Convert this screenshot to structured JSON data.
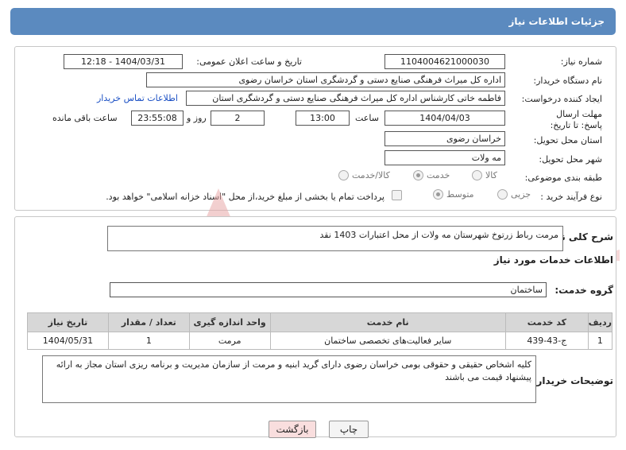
{
  "header": {
    "title": "جزئیات اطلاعات نیاز"
  },
  "form": {
    "need_number_label": "شماره نیاز:",
    "need_number": "1104004621000030",
    "announce_label": "تاریخ و ساعت اعلان عمومی:",
    "announce_value": "1404/03/31 - 12:18",
    "buyer_org_label": "نام دستگاه خریدار:",
    "buyer_org": "اداره کل میراث فرهنگی  صنایع دستی و گردشگری استان خراسان رضوی",
    "creator_label": "ایجاد کننده درخواست:",
    "creator": "فاطمه خاتی کارشناس اداره کل میراث فرهنگی  صنایع دستی و گردشگری استان",
    "contact_link": "اطلاعات تماس خریدار",
    "deadline_label": "مهلت ارسال پاسخ: تا تاریخ:",
    "deadline_date": "1404/04/03",
    "time_label": "ساعت",
    "deadline_time": "13:00",
    "days_value": "2",
    "days_label": "روز و",
    "remaining_value": "23:55:08",
    "remaining_label": "ساعت باقی مانده",
    "province_label": "استان محل تحویل:",
    "province": "خراسان رضوی",
    "city_label": "شهر محل تحویل:",
    "city": "مه ولات",
    "category_label": "طبقه بندی موضوعی:",
    "category_options": [
      "کالا",
      "خدمت",
      "کالا/خدمت"
    ],
    "process_label": "نوع فرآیند خرید :",
    "process_options": [
      "جزیی",
      "متوسط"
    ],
    "payment_note": "پرداخت تمام یا بخشی از مبلغ خرید،از محل \"اسناد خزانه اسلامی\" خواهد بود."
  },
  "summary": {
    "label": "شرح کلی نیاز:",
    "text": "مرمت رباط زرتوخ شهرستان مه ولات از محل اعتبارات 1403 نقد"
  },
  "services": {
    "title": "اطلاعات خدمات مورد نیاز",
    "group_label": "گروه خدمت:",
    "group_value": "ساختمان",
    "columns": [
      "ردیف",
      "کد خدمت",
      "نام خدمت",
      "واحد اندازه گیری",
      "تعداد / مقدار",
      "تاریخ نیاز"
    ],
    "rows": [
      {
        "row": "1",
        "code": "ج-43-439",
        "name": "سایر فعالیت‌های تخصصی ساختمان",
        "unit": "مرمت",
        "qty": "1",
        "date": "1404/05/31"
      }
    ]
  },
  "buyer_notes": {
    "label": "توضیحات خریدار:",
    "text": "کلیه اشخاص حقیقی و حقوقی بومی خراسان رضوی  دارای گرید ابنیه و مرمت از سازمان مدیریت و برنامه ریزی  استان مجاز به ارائه پیشنهاد قیمت می باشند"
  },
  "buttons": {
    "print": "چاپ",
    "back": "بازگشت"
  },
  "colors": {
    "header": "#5b8abf",
    "back_button": "#f9dede",
    "watermark": "#e9a9a9"
  }
}
